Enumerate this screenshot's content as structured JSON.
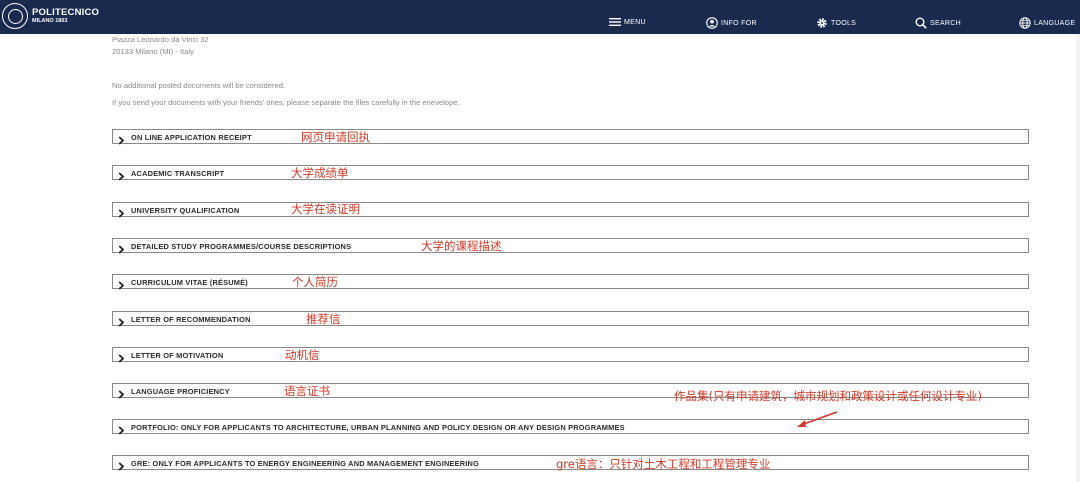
{
  "header": {
    "logo_name": "POLITECNICO",
    "logo_sub": "MILANO 1863",
    "nav": {
      "menu": "MENU",
      "info_for": "INFO FOR",
      "tools": "TOOLS",
      "search": "SEARCH",
      "language": "LANGUAGE"
    }
  },
  "address": {
    "line1": "Piazza Leonardo da Vinci 32",
    "line2": "20133 Milano (MI) - Italy"
  },
  "notes": {
    "line1": "No additional posted documents will be considered.",
    "line2": "If you send your documents with your friends' ones, please separate the files carefully in the enevelope."
  },
  "documents": [
    {
      "label": "ON LINE APPLICATION RECEIPT",
      "annotation": "网页申请回执"
    },
    {
      "label": "ACADEMIC TRANSCRIPT",
      "annotation": "大学成绩单"
    },
    {
      "label": "UNIVERSITY QUALIFICATION",
      "annotation": "大学在读证明"
    },
    {
      "label": "DETAILED STUDY PROGRAMMES/COURSE DESCRIPTIONS",
      "annotation": "大学的课程描述"
    },
    {
      "label": "CURRICULUM VITAE (RÉSUMÉ)",
      "annotation": "个人简历"
    },
    {
      "label": "LETTER OF RECOMMENDATION",
      "annotation": "推荐信"
    },
    {
      "label": "LETTER OF MOTIVATION",
      "annotation": "动机信"
    },
    {
      "label": "LANGUAGE PROFICIENCY",
      "annotation": "语言证书"
    },
    {
      "label": "PORTFOLIO: ONLY FOR APPLICANTS TO ARCHITECTURE, URBAN PLANNING AND POLICY DESIGN OR ANY DESIGN PROGRAMMES",
      "annotation": "作品集(只有申请建筑，城市规划和政策设计或任何设计专业)"
    },
    {
      "label": "GRE: ONLY FOR APPLICANTS TO ENERGY ENGINEERING AND MANAGEMENT ENGINEERING",
      "annotation": "gre语言：只针对土木工程和工程管理专业"
    }
  ],
  "colors": {
    "header_bg": "#1a2a4f",
    "annotation": "#d23a2a",
    "row_border": "#8a8a8a"
  },
  "icons": [
    "seal-logo",
    "menu-icon",
    "user-icon",
    "gear-icon",
    "search-icon",
    "globe-icon",
    "chevron-right-icon",
    "arrow-annotation"
  ]
}
